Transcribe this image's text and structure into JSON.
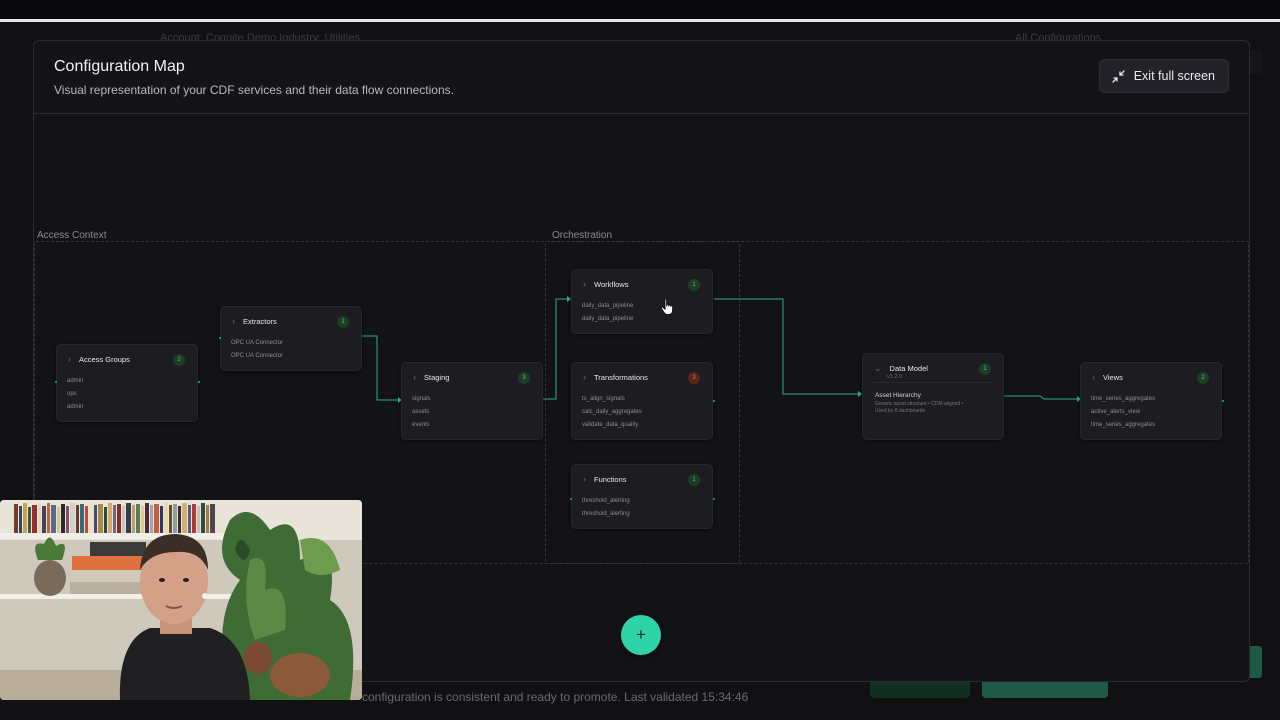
{
  "background": {
    "breadcrumb": [
      "Account:",
      "Cognite Demo",
      "Industry:",
      "Utilities"
    ],
    "breadcrumb_right": "All Configurations",
    "status_text": "configuration is consistent and ready to promote. Last validated 15:34:46"
  },
  "modal": {
    "title": "Configuration Map",
    "subtitle": "Visual representation of your CDF services and their data flow connections.",
    "exit_label": "Exit full screen",
    "exit_icon": "minimize-icon"
  },
  "groups": {
    "access_context": "Access Context",
    "orchestration": "Orchestration"
  },
  "nodes": {
    "access_groups": {
      "title": "Access Groups",
      "count": "2",
      "items": [
        "admin",
        "ops",
        "admin"
      ]
    },
    "extractors": {
      "title": "Extractors",
      "count": "1",
      "items": [
        "OPC UA Connector",
        "OPC UA Connector"
      ]
    },
    "staging": {
      "title": "Staging",
      "count": "3",
      "items": [
        "signals",
        "assets",
        "events"
      ]
    },
    "workflows": {
      "title": "Workflows",
      "count": "1",
      "items": [
        "daily_data_pipeline",
        "daily_data_pipeline"
      ]
    },
    "transformations": {
      "title": "Transformations",
      "count": "3",
      "items": [
        "ts_align_signals",
        "calc_daily_aggregates",
        "validate_data_quality"
      ]
    },
    "functions": {
      "title": "Functions",
      "count": "1",
      "items": [
        "threshold_alerting",
        "threshold_alerting"
      ]
    },
    "data_model": {
      "title": "Data Model",
      "version": "v1.2.0",
      "count": "1",
      "subtitle": "Asset Hierarchy",
      "desc_1": "Generic asset structure • CDM aligned •",
      "desc_2": "Used by 8 dashboards"
    },
    "views": {
      "title": "Views",
      "count": "2",
      "items": [
        "time_series_aggregates",
        "active_alerts_view",
        "time_series_aggregates"
      ]
    }
  },
  "colors": {
    "accent": "#2ed3a8",
    "edge": "#2fae85",
    "badge_ok": "#5ec27a",
    "badge_error": "#e8704a"
  },
  "fab": {
    "label": "+",
    "icon": "plus-icon"
  }
}
